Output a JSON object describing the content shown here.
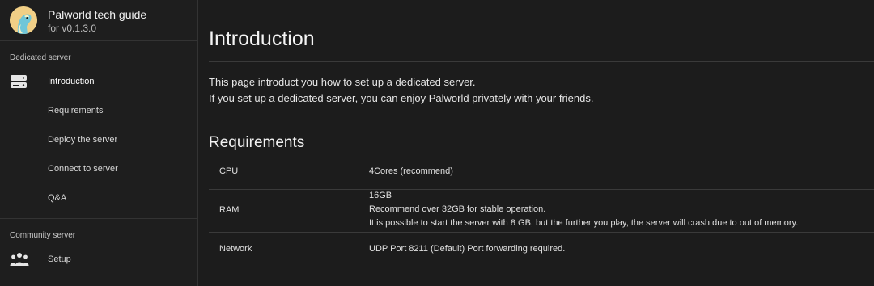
{
  "app": {
    "title": "Palworld tech guide",
    "version": "for v0.1.3.0"
  },
  "sidebar": {
    "sections": [
      {
        "title": "Dedicated server",
        "items": [
          {
            "label": "Introduction",
            "icon": "server-icon",
            "active": true
          },
          {
            "label": "Requirements"
          },
          {
            "label": "Deploy the server"
          },
          {
            "label": "Connect to server"
          },
          {
            "label": "Q&A"
          }
        ]
      },
      {
        "title": "Community server",
        "items": [
          {
            "label": "Setup",
            "icon": "group-icon"
          }
        ]
      }
    ]
  },
  "main": {
    "title": "Introduction",
    "intro_lines": [
      "This page introduct you how to set up a dedicated server.",
      "If you set up a dedicated server, you can enjoy Palworld privately with your friends."
    ],
    "requirements": {
      "heading": "Requirements",
      "rows": [
        {
          "key": "CPU",
          "lines": [
            "4Cores (recommend)"
          ]
        },
        {
          "key": "RAM",
          "lines": [
            "16GB",
            "Recommend over 32GB for stable operation.",
            "It is possible to start the server with 8 GB, but the further you play, the server will crash due to out of memory."
          ]
        },
        {
          "key": "Network",
          "lines": [
            "UDP Port 8211 (Default) Port forwarding required."
          ]
        }
      ]
    }
  },
  "colors": {
    "background": "#1c1c1c",
    "sidebar": "#1e1e1e",
    "divider": "#333333",
    "text": "#e8e8e8"
  }
}
